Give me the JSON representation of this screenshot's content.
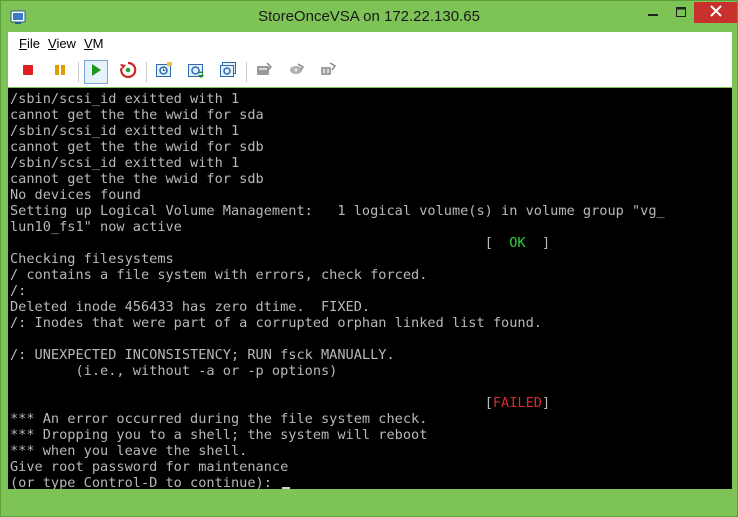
{
  "window": {
    "title": "StoreOnceVSA on 172.22.130.65",
    "icon": "vmware-console-icon",
    "controls": [
      "minimize-icon",
      "maximize-icon",
      "close-icon"
    ],
    "accent_color": "#7ec356",
    "close_color": "#c7302b"
  },
  "menu": [
    {
      "label": "File",
      "mnemonic": "F",
      "rest": "ile"
    },
    {
      "label": "View",
      "mnemonic": "V",
      "rest": "iew"
    },
    {
      "label": "VM",
      "mnemonic": "V",
      "rest": "M"
    }
  ],
  "toolbar": {
    "buttons": [
      {
        "name": "power-off-button",
        "icon": "stop-icon",
        "color": "#e02020"
      },
      {
        "name": "suspend-button",
        "icon": "pause-icon",
        "color": "#e69a00"
      },
      {
        "name": "power-on-button",
        "icon": "play-icon",
        "color": "#1a9a1a",
        "active": true
      },
      {
        "name": "reset-button",
        "icon": "reset-icon",
        "color": "#d02525"
      },
      {
        "name": "snapshot-button",
        "icon": "snapshot-icon"
      },
      {
        "name": "revert-snapshot-button",
        "icon": "revert-snapshot-icon"
      },
      {
        "name": "snapshot-manager-button",
        "icon": "snapshot-manager-icon"
      },
      {
        "name": "cd-dvd-button",
        "icon": "disk-icon",
        "disabled": true
      },
      {
        "name": "floppy-button",
        "icon": "floppy-icon",
        "disabled": true
      },
      {
        "name": "network-button",
        "icon": "network-adapter-icon",
        "disabled": true
      }
    ]
  },
  "console": {
    "lines": [
      "/sbin/scsi_id exitted with 1",
      "cannot get the the wwid for sda",
      "/sbin/scsi_id exitted with 1",
      "cannot get the the wwid for sdb",
      "/sbin/scsi_id exitted with 1",
      "cannot get the the wwid for sdb",
      "No devices found",
      "Setting up Logical Volume Management:   1 logical volume(s) in volume group \"vg_",
      "lun10_fs1\" now active",
      "",
      "Checking filesystems",
      "/ contains a file system with errors, check forced.",
      "/:",
      "Deleted inode 456433 has zero dtime.  FIXED.",
      "/: Inodes that were part of a corrupted orphan linked list found.",
      "",
      "/: UNEXPECTED INCONSISTENCY; RUN fsck MANUALLY.",
      "        (i.e., without -a or -p options)",
      "",
      "",
      "*** An error occurred during the file system check.",
      "*** Dropping you to a shell; the system will reboot",
      "*** when you leave the shell.",
      "Give root password for maintenance",
      "(or type Control-D to continue): "
    ],
    "status_ok": {
      "line": 9,
      "indent": "                                                          ",
      "open": "[  ",
      "word": "OK",
      "close": "  ]"
    },
    "status_failed": {
      "line": 19,
      "indent": "                                                          ",
      "open": "[",
      "word": "FAILED",
      "close": "]"
    },
    "text_color": "#b8b8b8",
    "ok_color": "#2fd23b",
    "failed_color": "#d42c2c"
  }
}
